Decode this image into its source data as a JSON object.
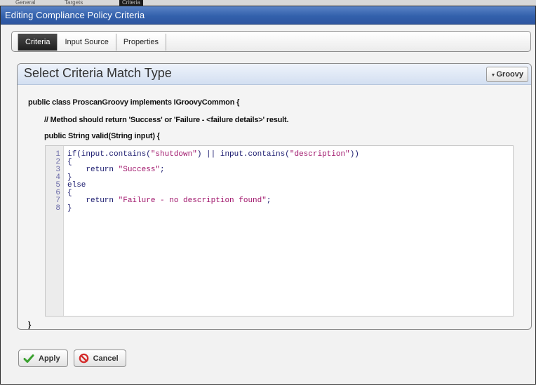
{
  "dialog": {
    "title": "Editing Compliance Policy Criteria"
  },
  "tabs": [
    {
      "label": "Criteria",
      "active": true
    },
    {
      "label": "Input Source",
      "active": false
    },
    {
      "label": "Properties",
      "active": false
    }
  ],
  "panel": {
    "title": "Select Criteria Match Type",
    "language_button": "Groovy"
  },
  "code_header": {
    "class_decl": "public class ProscanGroovy implements IGroovyCommon {",
    "comment": "// Method should return 'Success' or 'Failure - <failure details>' result.",
    "method_decl": "public String valid(String input) {",
    "closing_brace": "}"
  },
  "editor": {
    "line_numbers": [
      "1",
      "2",
      "3",
      "4",
      "5",
      "6",
      "7",
      "8"
    ],
    "lines": [
      [
        {
          "t": "if(input.contains(",
          "c": ""
        },
        {
          "t": "\"shutdown\"",
          "c": "str"
        },
        {
          "t": ") || input.contains(",
          "c": ""
        },
        {
          "t": "\"description\"",
          "c": "str"
        },
        {
          "t": "))",
          "c": ""
        }
      ],
      [
        {
          "t": "{",
          "c": ""
        }
      ],
      [
        {
          "t": "    return ",
          "c": ""
        },
        {
          "t": "\"Success\"",
          "c": "str"
        },
        {
          "t": ";",
          "c": ""
        }
      ],
      [
        {
          "t": "}",
          "c": ""
        }
      ],
      [
        {
          "t": "else",
          "c": ""
        }
      ],
      [
        {
          "t": "{",
          "c": ""
        }
      ],
      [
        {
          "t": "    return ",
          "c": ""
        },
        {
          "t": "\"Failure - no description found\"",
          "c": "str"
        },
        {
          "t": ";",
          "c": ""
        }
      ],
      [
        {
          "t": "}",
          "c": ""
        }
      ]
    ]
  },
  "buttons": {
    "apply": "Apply",
    "cancel": "Cancel"
  },
  "colors": {
    "titlebar": "#3361ac",
    "string_literal": "#a0156b",
    "apply_icon": "#3aa12f",
    "cancel_icon": "#d42a2a"
  },
  "icons": {
    "apply": "check-icon",
    "cancel": "cancel-icon",
    "language": "caret-down-icon"
  },
  "background_tabs": [
    "General",
    "Targets",
    "Criteria"
  ]
}
